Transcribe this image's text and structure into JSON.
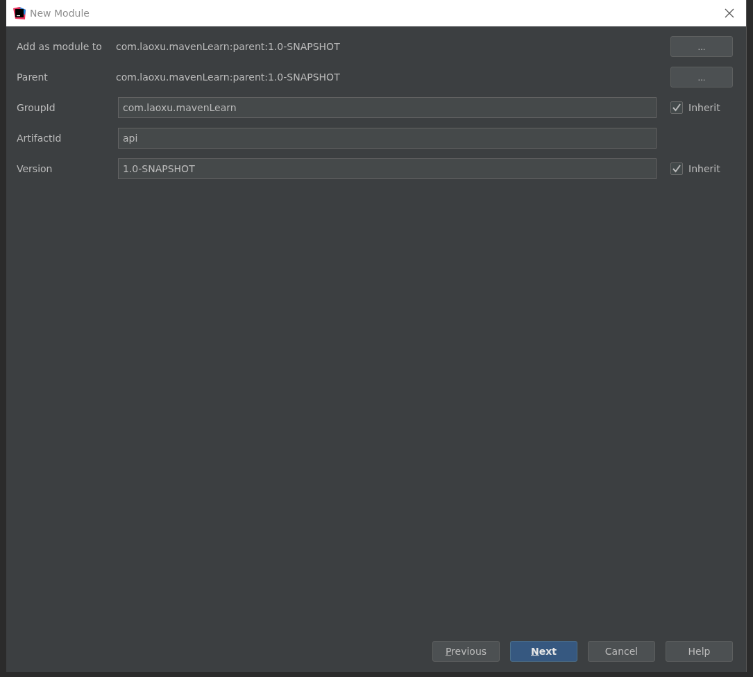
{
  "window": {
    "title": "New Module"
  },
  "rows": [
    {
      "label": "Add as module to",
      "kind": "text",
      "value": "com.laoxu.mavenLearn:parent:1.0-SNAPSHOT",
      "action": {
        "kind": "browse",
        "label": "..."
      }
    },
    {
      "label": "Parent",
      "kind": "text",
      "value": "com.laoxu.mavenLearn:parent:1.0-SNAPSHOT",
      "action": {
        "kind": "browse",
        "label": "..."
      }
    },
    {
      "label": "GroupId",
      "kind": "field",
      "value": "com.laoxu.mavenLearn",
      "action": {
        "kind": "checkbox",
        "label": "Inherit",
        "checked": true
      }
    },
    {
      "label": "ArtifactId",
      "kind": "field",
      "value": "api"
    },
    {
      "label": "Version",
      "kind": "field",
      "value": "1.0-SNAPSHOT",
      "action": {
        "kind": "checkbox",
        "label": "Inherit",
        "checked": true
      }
    }
  ],
  "buttons": [
    {
      "label": "Previous",
      "underlined_first_letter": true,
      "default": false
    },
    {
      "label": "Next",
      "underlined_first_letter": true,
      "default": true
    },
    {
      "label": "Cancel",
      "default": false
    },
    {
      "label": "Help",
      "default": false
    }
  ]
}
